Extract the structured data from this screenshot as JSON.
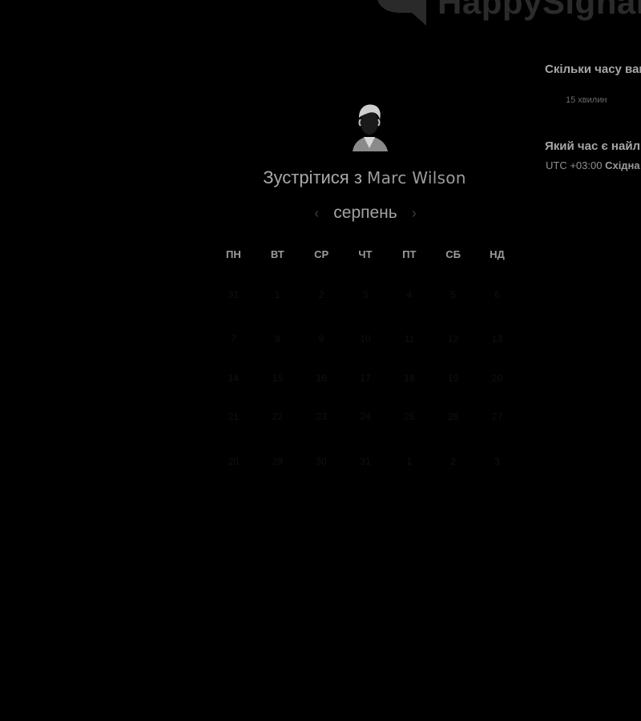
{
  "brand": {
    "name": "HappySignals",
    "logo_color": "#2b2b2b"
  },
  "scheduler": {
    "heading_prefix": "Зустрітися з",
    "host_name": "Marc Wilson",
    "month": "серпень",
    "prev_icon": "chevron-left-icon",
    "next_icon": "chevron-right-icon",
    "weekdays": [
      "ПН",
      "ВТ",
      "СР",
      "ЧТ",
      "ПТ",
      "СБ",
      "НД"
    ],
    "weeks": [
      [
        "31",
        "1",
        "2",
        "3",
        "4",
        "5",
        "6"
      ],
      [
        "7",
        "8",
        "9",
        "10",
        "11",
        "12",
        "13"
      ],
      [
        "14",
        "15",
        "16",
        "17",
        "18",
        "19",
        "20"
      ],
      [
        "21",
        "22",
        "23",
        "24",
        "25",
        "26",
        "27"
      ],
      [
        "28",
        "29",
        "30",
        "31",
        "1",
        "2",
        "3"
      ]
    ]
  },
  "side_panel": {
    "duration_question": "Скільки часу вам потрібно?",
    "duration_option": "15 хвилин",
    "time_question": "Який час є найліпшим?",
    "timezone_offset": "UTC +03:00",
    "timezone_name": "Східна Європа"
  },
  "colors": {
    "background": "#000000",
    "text_primary": "#a9a9a9",
    "text_muted": "#6a6a6a"
  }
}
